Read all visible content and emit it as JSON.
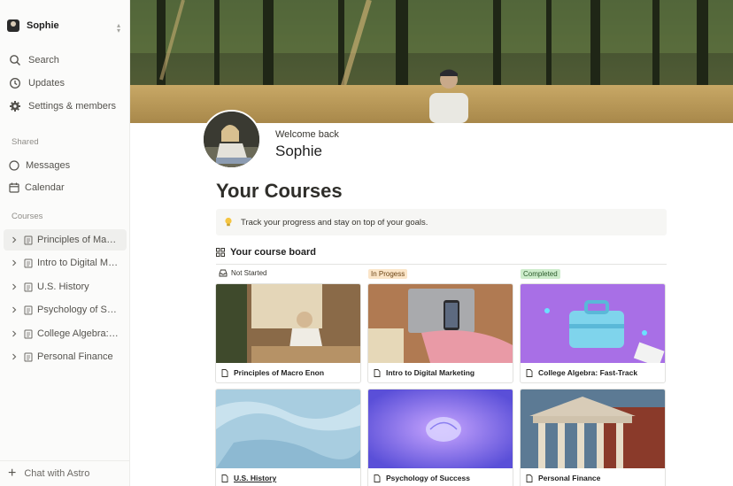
{
  "workspace": {
    "name": "Sophie"
  },
  "sidebar": {
    "nav": [
      {
        "label": "Search",
        "icon": "search-icon"
      },
      {
        "label": "Updates",
        "icon": "clock-icon"
      },
      {
        "label": "Settings & members",
        "icon": "gear-icon"
      }
    ],
    "shared_label": "Shared",
    "shared": [
      {
        "label": "Messages",
        "icon": "chat-bubble-icon"
      },
      {
        "label": "Calendar",
        "icon": "calendar-icon"
      }
    ],
    "courses_label": "Courses",
    "courses": [
      {
        "label": "Principles of Macro Enon"
      },
      {
        "label": "Intro to Digital Marketing"
      },
      {
        "label": "U.S. History"
      },
      {
        "label": "Psychology of Success"
      },
      {
        "label": "College Algebra: Fast-Track"
      },
      {
        "label": "Personal Finance"
      }
    ],
    "chat": "Chat with Astro"
  },
  "header": {
    "welcome": "Welcome back",
    "username": "Sophie"
  },
  "page": {
    "title": "Your Courses",
    "callout": "Track your progress and stay on top of your goals.",
    "board_title": "Your course board"
  },
  "board": {
    "columns": [
      {
        "label": "Not Started"
      },
      {
        "label": "In Progess"
      },
      {
        "label": "Completed"
      }
    ],
    "cards": [
      {
        "title": "Principles of Macro Enon"
      },
      {
        "title": "Intro to Digital Marketing"
      },
      {
        "title": "College Algebra: Fast-Track"
      },
      {
        "title": "U.S. History"
      },
      {
        "title": "Psychology of Success"
      },
      {
        "title": "Personal Finance"
      }
    ]
  },
  "colors": {
    "in_progress_tag": "#fbe5c8",
    "completed_tag": "#cdeccb",
    "sidebar_bg": "#fbfbfa"
  }
}
